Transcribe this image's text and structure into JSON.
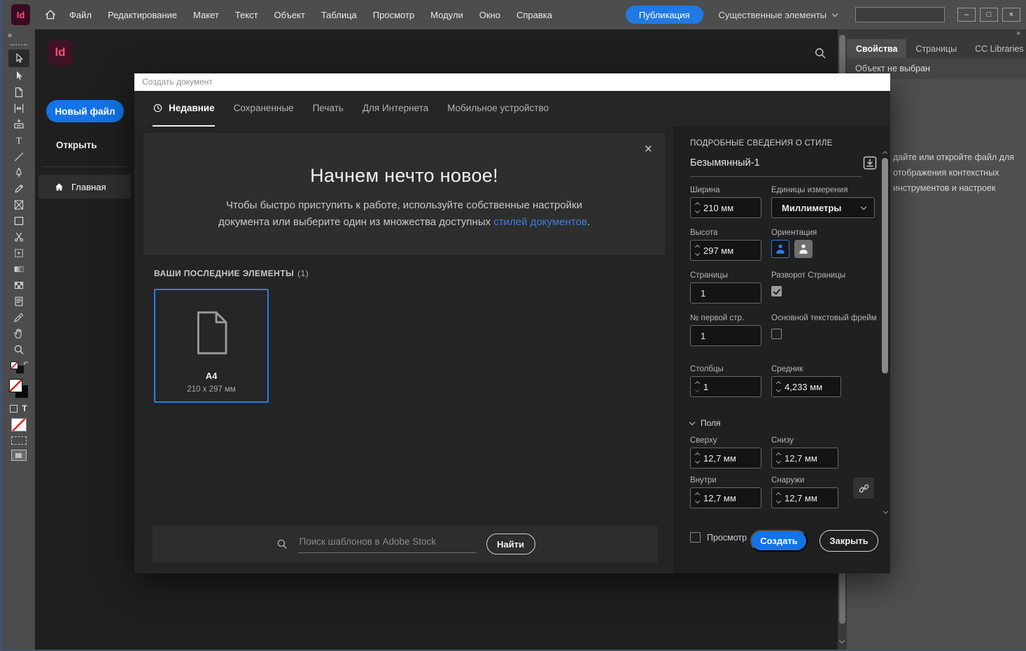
{
  "colors": {
    "accent": "#1473e6",
    "link": "#3d7fd6",
    "card_border": "#2b7de9",
    "publish": "#2179e2"
  },
  "window": {
    "logo_text": "Id",
    "controls": {
      "minimize": "–",
      "maximize": "□",
      "close": "×"
    }
  },
  "menubar": {
    "items": [
      {
        "name": "file",
        "label": "Файл"
      },
      {
        "name": "edit",
        "label": "Редактирование"
      },
      {
        "name": "layout",
        "label": "Макет"
      },
      {
        "name": "type",
        "label": "Текст"
      },
      {
        "name": "object",
        "label": "Объект"
      },
      {
        "name": "table",
        "label": "Таблица"
      },
      {
        "name": "view",
        "label": "Просмотр"
      },
      {
        "name": "plugins",
        "label": "Модули"
      },
      {
        "name": "window",
        "label": "Окно"
      },
      {
        "name": "help",
        "label": "Справка"
      }
    ],
    "publish_button": "Публикация",
    "workspace_switcher": "Существенные элементы"
  },
  "toolbar": {
    "expand": "»",
    "tools": [
      {
        "name": "selection-tool",
        "icon": "select",
        "active": true
      },
      {
        "name": "direct-selection-tool",
        "icon": "direct"
      },
      {
        "name": "page-tool",
        "icon": "page"
      },
      {
        "name": "gap-tool",
        "icon": "gap"
      },
      {
        "name": "content-collector-tool",
        "icon": "collect"
      },
      {
        "name": "type-tool",
        "icon": "type"
      },
      {
        "name": "line-tool",
        "icon": "line"
      },
      {
        "name": "pen-tool",
        "icon": "pen"
      },
      {
        "name": "pencil-tool",
        "icon": "pencil"
      },
      {
        "name": "frame-tool",
        "icon": "frame"
      },
      {
        "name": "rectangle-tool",
        "icon": "rect"
      },
      {
        "name": "scissors-tool",
        "icon": "scissors"
      },
      {
        "name": "free-transform-tool",
        "icon": "transform"
      },
      {
        "name": "gradient-swatch-tool",
        "icon": "gradient"
      },
      {
        "name": "gradient-feather-tool",
        "icon": "feather"
      },
      {
        "name": "note-tool",
        "icon": "note"
      },
      {
        "name": "eyedropper-tool",
        "icon": "eyedrop"
      },
      {
        "name": "hand-tool",
        "icon": "hand"
      },
      {
        "name": "zoom-tool",
        "icon": "zoom"
      }
    ]
  },
  "home_sidebar": {
    "new_file": "Новый файл",
    "open": "Открыть",
    "home": "Главная"
  },
  "dialog": {
    "title": "Создать документ",
    "tabs": [
      {
        "name": "recent",
        "label": "Недавние",
        "icon": "clock",
        "active": true
      },
      {
        "name": "saved",
        "label": "Сохраненные"
      },
      {
        "name": "print",
        "label": "Печать"
      },
      {
        "name": "web",
        "label": "Для Интернета"
      },
      {
        "name": "mobile",
        "label": "Мобильное устройство"
      }
    ],
    "banner": {
      "heading": "Начнем нечто новое!",
      "body_line1": "Чтобы быстро приступить к работе, используйте собственные настройки",
      "body_line2_pre": "документа или выберите один из множества доступных ",
      "body_link": "стилей документов",
      "body_end": "."
    },
    "recent": {
      "heading": "ВАШИ ПОСЛЕДНИЕ ЭЛЕМЕНТЫ",
      "count": "(1)",
      "items": [
        {
          "title": "A4",
          "dims": "210 x 297 мм"
        }
      ]
    },
    "search": {
      "placeholder": "Поиск шаблонов в Adobe Stock",
      "button": "Найти"
    },
    "details": {
      "heading": "ПОДРОБНЫЕ СВЕДЕНИЯ О СТИЛЕ",
      "doc_name": "Безымянный-1",
      "width": {
        "label": "Ширина",
        "value": "210 мм"
      },
      "units": {
        "label": "Единицы измерения",
        "value": "Миллиметры"
      },
      "height": {
        "label": "Высота",
        "value": "297 мм"
      },
      "orientation_label": "Ориентация",
      "pages": {
        "label": "Страницы",
        "value": "1"
      },
      "facing_pages": {
        "label": "Разворот Страницы",
        "checked": true
      },
      "start_page": {
        "label": "№ первой стр.",
        "value": "1"
      },
      "primary_text_frame": {
        "label": "Основной текстовый фрейм",
        "checked": false
      },
      "columns": {
        "label": "Столбцы",
        "value": "1"
      },
      "gutter": {
        "label": "Средник",
        "value": "4,233 мм"
      },
      "margins": {
        "heading": "Поля",
        "top": {
          "label": "Сверху",
          "value": "12,7 мм"
        },
        "bottom": {
          "label": "Снизу",
          "value": "12,7 мм"
        },
        "inside": {
          "label": "Внутри",
          "value": "12,7 мм"
        },
        "outside": {
          "label": "Снаружи",
          "value": "12,7 мм"
        }
      },
      "preview_label": "Просмотр",
      "create_button": "Создать",
      "close_button": "Закрыть"
    }
  },
  "properties_panel": {
    "tabs": [
      {
        "name": "properties",
        "label": "Свойства",
        "active": true
      },
      {
        "name": "pages",
        "label": "Страницы"
      },
      {
        "name": "cc-libraries",
        "label": "CC Libraries"
      }
    ],
    "no_selection": "Объект не выбран",
    "hint_lines": [
      "дайте или откройте файл для",
      "отображения контекстных",
      "инструментов и настроек"
    ]
  }
}
